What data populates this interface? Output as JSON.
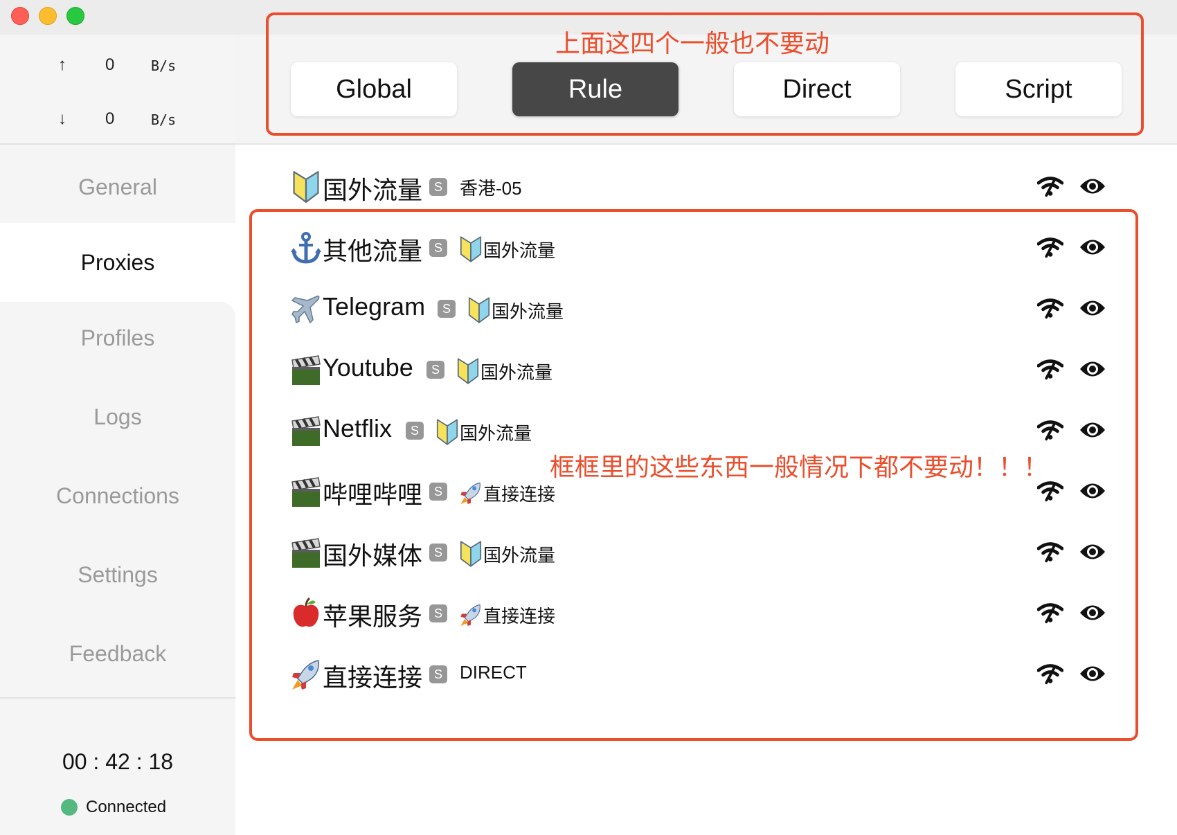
{
  "window": {
    "traffic_lights": [
      "close",
      "minimize",
      "zoom"
    ]
  },
  "speed": {
    "upload": {
      "arrow": "↑",
      "value": "0",
      "unit": "B/s"
    },
    "download": {
      "arrow": "↓",
      "value": "0",
      "unit": "B/s"
    }
  },
  "nav": {
    "items": [
      {
        "label": "General"
      },
      {
        "label": "Proxies"
      },
      {
        "label": "Profiles"
      },
      {
        "label": "Logs"
      },
      {
        "label": "Connections"
      },
      {
        "label": "Settings"
      },
      {
        "label": "Feedback"
      }
    ],
    "active": "Proxies"
  },
  "timer": "00 : 42 : 18",
  "status": {
    "label": "Connected",
    "color": "#55b881"
  },
  "modes": {
    "items": [
      {
        "label": "Global"
      },
      {
        "label": "Rule"
      },
      {
        "label": "Direct"
      },
      {
        "label": "Script"
      }
    ],
    "active": "Rule"
  },
  "annotations": {
    "modes_note": "上面这四个一般也不要动",
    "groups_note": "框框里的这些东西一般情况下都不要动！！！",
    "color": "#ea4e2c"
  },
  "proxy_groups": [
    {
      "icon": "shield-emoji-icon",
      "name": "国外流量",
      "badge": "S",
      "selected_icon": "",
      "selected": "香港-05"
    },
    {
      "icon": "anchor-emoji-icon",
      "name": "其他流量",
      "badge": "S",
      "selected_icon": "shield-emoji-icon",
      "selected": "国外流量"
    },
    {
      "icon": "airplane-emoji-icon",
      "name": "Telegram",
      "badge": "S",
      "selected_icon": "shield-emoji-icon",
      "selected": "国外流量"
    },
    {
      "icon": "clapper-emoji-icon",
      "name": "Youtube",
      "badge": "S",
      "selected_icon": "shield-emoji-icon",
      "selected": "国外流量"
    },
    {
      "icon": "clapper-emoji-icon",
      "name": "Netflix",
      "badge": "S",
      "selected_icon": "shield-emoji-icon",
      "selected": "国外流量"
    },
    {
      "icon": "clapper-emoji-icon",
      "name": "哔哩哔哩",
      "badge": "S",
      "selected_icon": "rocket-emoji-icon",
      "selected": "直接连接"
    },
    {
      "icon": "clapper-emoji-icon",
      "name": "国外媒体",
      "badge": "S",
      "selected_icon": "shield-emoji-icon",
      "selected": "国外流量"
    },
    {
      "icon": "apple-emoji-icon",
      "name": "苹果服务",
      "badge": "S",
      "selected_icon": "rocket-emoji-icon",
      "selected": "直接连接"
    },
    {
      "icon": "rocket-emoji-icon",
      "name": "直接连接",
      "badge": "S",
      "selected_icon": "",
      "selected": "DIRECT"
    }
  ],
  "row_actions": {
    "latency_icon": "wifi-latency-icon",
    "view_icon": "eye-icon"
  }
}
